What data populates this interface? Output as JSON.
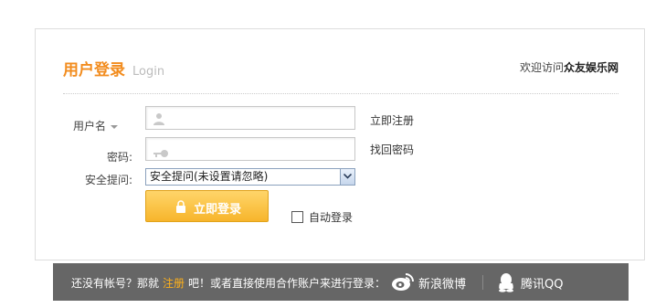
{
  "header": {
    "title_cn": "用户登录",
    "title_en": "Login",
    "welcome_prefix": "欢迎访问",
    "site_name": "众友娱乐网"
  },
  "form": {
    "username_label": "用户名",
    "password_label": "密码:",
    "security_label": "安全提问:",
    "security_selected": "安全提问(未设置请忽略)",
    "register_link": "立即注册",
    "recover_link": "找回密码",
    "login_button": "立即登录",
    "auto_login": "自动登录"
  },
  "footer": {
    "prefix": "还没有帐号？那就",
    "register": "注册",
    "suffix": "吧！或者直接使用合作账户来进行登录：",
    "weibo": "新浪微博",
    "qq": "腾讯QQ"
  },
  "colors": {
    "accent": "#f28c1e",
    "button": "#f7b52b",
    "footer_bg": "#666666",
    "register_highlight": "#ffb11b"
  },
  "icons": [
    "user-icon",
    "key-icon",
    "chevron-down-icon",
    "lock-icon",
    "weibo-icon",
    "qq-icon"
  ]
}
